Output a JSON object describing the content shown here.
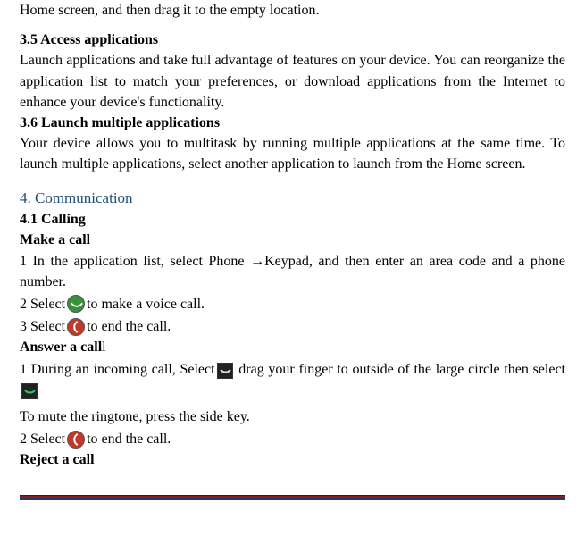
{
  "intro_tail": "Home screen, and then drag it to the empty location.",
  "s35": {
    "heading": "3.5 Access applications",
    "body": "Launch applications and take full advantage of features on your device. You can reorganize the application list to match your preferences, or download applications from the Internet to enhance your device's functionality."
  },
  "s36": {
    "heading": "3.6 Launch multiple applications",
    "body": "Your device allows you to multitask by running multiple applications at the same time. To launch multiple applications, select another application to launch from the Home screen."
  },
  "comm": {
    "heading": "4. Communication",
    "s41": "4.1 Calling",
    "make_a_call": "Make a call",
    "step1": "1 In the application list, select Phone →Keypad, and then enter an area code and a phone number.",
    "step2_pre": "2 Select ",
    "step2_post": " to make a voice call.",
    "step3_pre": "3 Select ",
    "step3_post": " to end the call.",
    "answer_a_call": "Answer a call",
    "ans1_pre": "1 During an incoming call, Select",
    "ans1_mid": " drag your finger to outside of the large circle then select",
    "mute": "To mute the ringtone, press the side key.",
    "ans2_pre": " 2 Select ",
    "ans2_post": " to end the call.",
    "reject": "Reject a call"
  },
  "icons": {
    "call": "call-icon",
    "end": "end-call-icon",
    "incoming": "incoming-call-icon",
    "incoming_accept": "incoming-accept-icon"
  }
}
